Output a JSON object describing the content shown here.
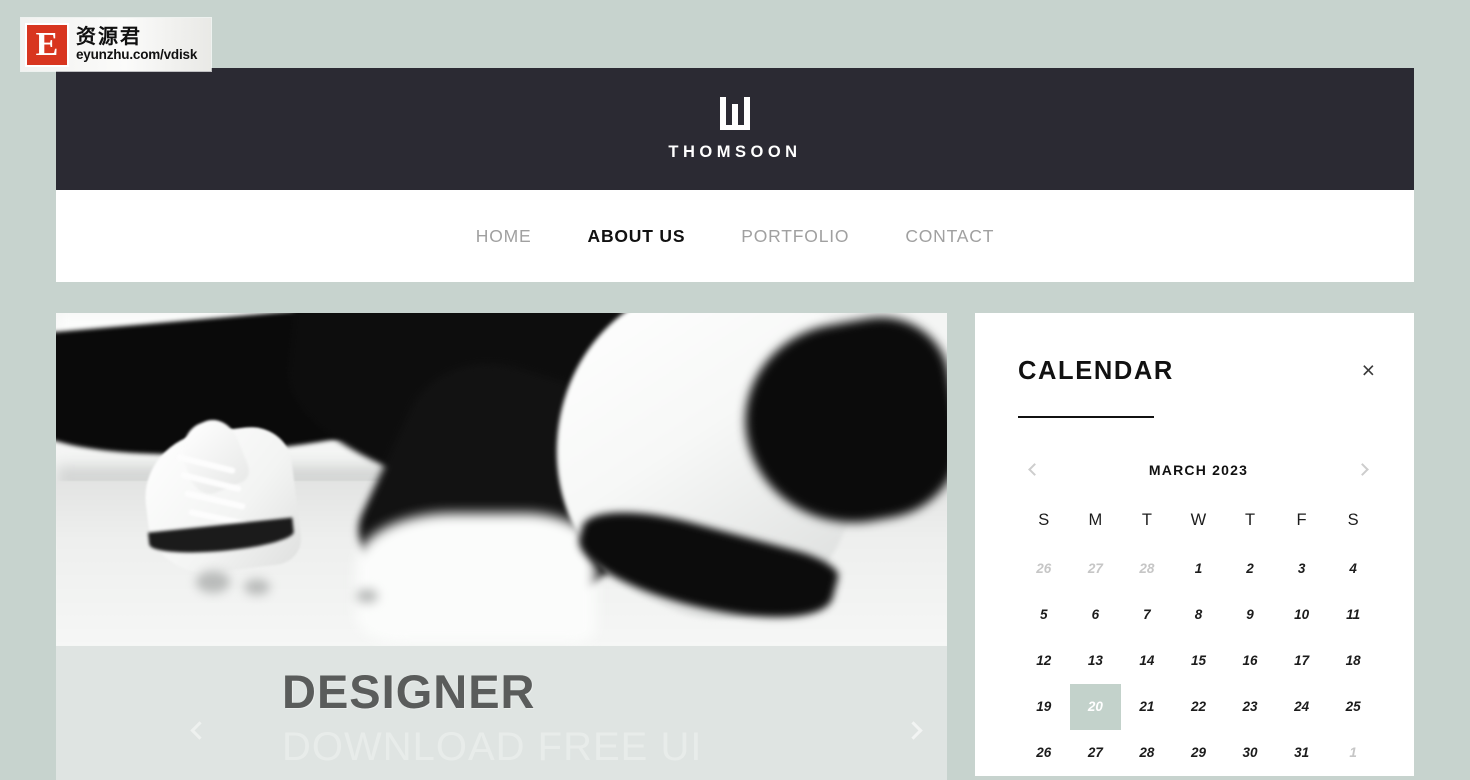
{
  "watermark": {
    "badge_letter": "E",
    "cn_text": "资源君",
    "url": "eyunzhu.com/vdisk"
  },
  "brand": {
    "name": "THOMSOON",
    "logo_icon": "logo-mark-pillars",
    "bar_color": "#2b2a33"
  },
  "nav": {
    "items": [
      {
        "label": "HOME",
        "active": false
      },
      {
        "label": "ABOUT US",
        "active": true
      },
      {
        "label": "PORTFOLIO",
        "active": false
      },
      {
        "label": "CONTACT",
        "active": false
      }
    ]
  },
  "slider": {
    "image_alt": "black-and-white photo of sneakers on pavement",
    "title": "DESIGNER",
    "subtitle": "DOWNLOAD FREE UI",
    "prev_icon": "chevron-left-icon",
    "next_icon": "chevron-right-icon",
    "caption_bg": "#dfe4e2"
  },
  "calendar": {
    "title": "CALENDAR",
    "close_icon": "close-icon",
    "close_label": "×",
    "prev_icon": "chevron-left-icon",
    "next_icon": "chevron-right-icon",
    "month_label": "MARCH 2023",
    "weekdays": [
      "S",
      "M",
      "T",
      "W",
      "T",
      "F",
      "S"
    ],
    "selected_day": 20,
    "selected_bg": "#c3d2cb",
    "weeks": [
      [
        {
          "d": "26",
          "muted": true
        },
        {
          "d": "27",
          "muted": true
        },
        {
          "d": "28",
          "muted": true
        },
        {
          "d": "1"
        },
        {
          "d": "2"
        },
        {
          "d": "3"
        },
        {
          "d": "4"
        }
      ],
      [
        {
          "d": "5"
        },
        {
          "d": "6"
        },
        {
          "d": "7"
        },
        {
          "d": "8"
        },
        {
          "d": "9"
        },
        {
          "d": "10"
        },
        {
          "d": "11"
        }
      ],
      [
        {
          "d": "12"
        },
        {
          "d": "13"
        },
        {
          "d": "14"
        },
        {
          "d": "15"
        },
        {
          "d": "16"
        },
        {
          "d": "17"
        },
        {
          "d": "18"
        }
      ],
      [
        {
          "d": "19"
        },
        {
          "d": "20",
          "selected": true
        },
        {
          "d": "21"
        },
        {
          "d": "22"
        },
        {
          "d": "23"
        },
        {
          "d": "24"
        },
        {
          "d": "25"
        }
      ],
      [
        {
          "d": "26"
        },
        {
          "d": "27"
        },
        {
          "d": "28"
        },
        {
          "d": "29"
        },
        {
          "d": "30"
        },
        {
          "d": "31"
        },
        {
          "d": "1",
          "muted": true
        }
      ]
    ]
  },
  "theme": {
    "page_bg": "#c7d3ce",
    "accent": "#c3d2cb",
    "ink": "#1c1c1c",
    "muted": "#a0a0a0"
  }
}
